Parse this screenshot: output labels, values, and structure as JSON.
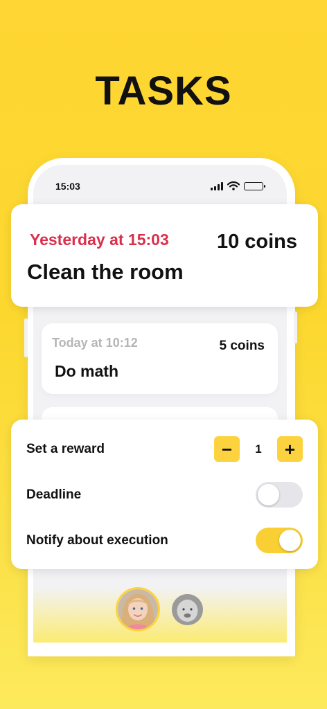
{
  "header": {
    "title": "TASKS"
  },
  "phone": {
    "status_bar": {
      "time": "15:03"
    }
  },
  "tasks": [
    {
      "when": "Yesterday at 15:03",
      "title": "Clean the room",
      "reward": "10 coins",
      "overdue": true,
      "accent_color": "#d8304d"
    },
    {
      "when": "Today at 10:12",
      "title": "Do math",
      "reward": "5 coins",
      "overdue": false
    }
  ],
  "settings": {
    "reward": {
      "label": "Set a reward",
      "decrement": "−",
      "value": "1",
      "increment": "+"
    },
    "deadline": {
      "label": "Deadline",
      "enabled": false
    },
    "notify": {
      "label": "Notify about execution",
      "enabled": true
    }
  },
  "profiles": [
    {
      "name": "girl-avatar",
      "active": true
    },
    {
      "name": "baby-avatar",
      "active": false
    }
  ],
  "colors": {
    "background": "#fcd82f",
    "accent": "#fcd33f",
    "overdue": "#d8304d",
    "toggle_off": "#e5e5ea"
  }
}
